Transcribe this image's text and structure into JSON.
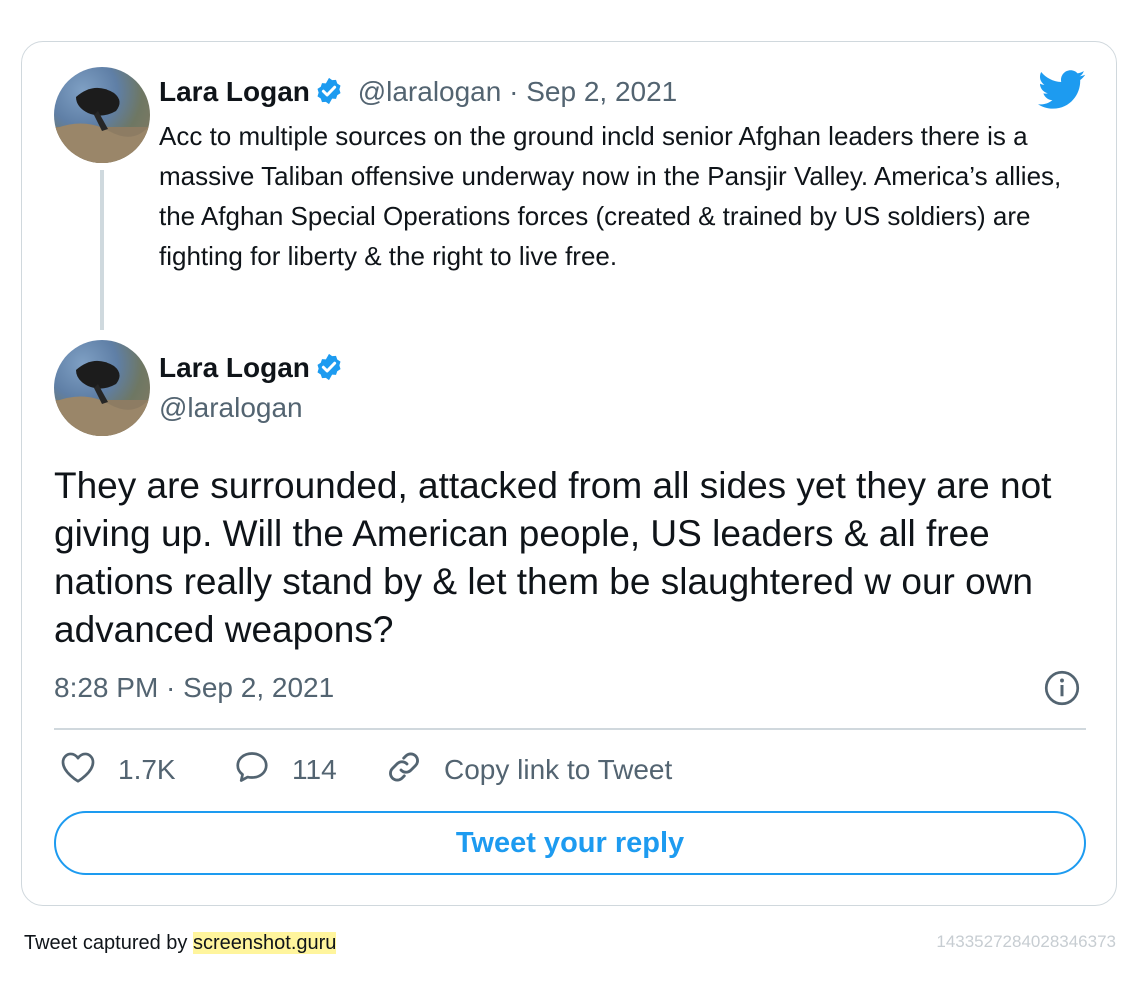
{
  "parent_tweet": {
    "author_name": "Lara Logan",
    "handle": "@laralogan",
    "separator": "·",
    "date": "Sep 2, 2021",
    "text": "Acc to multiple sources on the ground incld senior Afghan leaders there is a massive Taliban offensive underway now in the Pansjir Valley. America’s allies, the Afghan Special Operations forces (created & trained by US soldiers) are fighting for liberty & the right to live free."
  },
  "main_tweet": {
    "author_name": "Lara Logan",
    "handle": "@laralogan",
    "text": "They are surrounded, attacked from all sides yet they are not giving up. Will the American people, US leaders & all free nations really stand by & let them be slaughtered w our own advanced weapons?",
    "timestamp": "8:28 PM · Sep 2, 2021"
  },
  "actions": {
    "likes": "1.7K",
    "replies": "114",
    "copy_link": "Copy link to Tweet"
  },
  "reply_button": "Tweet your reply",
  "footer": {
    "prefix": "Tweet captured by ",
    "site": "screenshot.guru",
    "tweet_id": "1433527284028346373"
  },
  "icons": {
    "brand": "twitter-bird-icon",
    "verified": "verified-badge-icon",
    "info": "info-icon",
    "like": "heart-icon",
    "reply": "comment-icon",
    "link": "link-icon"
  },
  "colors": {
    "accent": "#1d9bf0",
    "secondary_text": "#536471",
    "border": "#d0d8dd",
    "highlight": "#fff59d"
  }
}
